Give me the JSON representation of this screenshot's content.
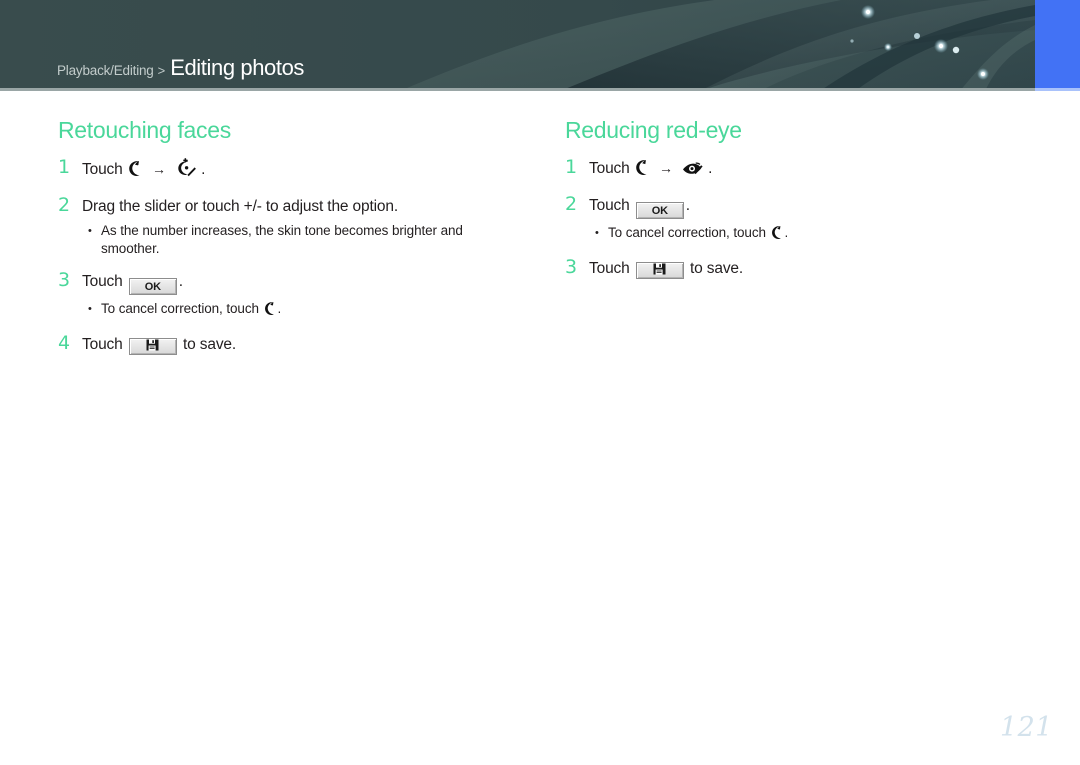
{
  "header": {
    "breadcrumb_parent": "Playback/Editing",
    "breadcrumb_separator": ">",
    "breadcrumb_current": "Editing photos",
    "background_color": "#3a4d4e",
    "accent_color": "#4272f5"
  },
  "theme": {
    "heading_color": "#4ad79a",
    "body_text_color": "#231f20",
    "page_number_color": "#d3e2ec"
  },
  "left_column": {
    "title": "Retouching faces",
    "steps": [
      {
        "number": "1",
        "text_before": "Touch",
        "icon_1": "face-retouch-cancel-icon",
        "arrow": "→",
        "icon_2": "face-retouch-icon",
        "text_after": "."
      },
      {
        "number": "2",
        "text": "Drag the slider or touch +/- to adjust the option.",
        "bullets": [
          "As the number increases, the skin tone becomes brighter and smoother."
        ]
      },
      {
        "number": "3",
        "text_before": "Touch",
        "button_label": "OK",
        "text_after": ".",
        "bullets_before": "To cancel correction, touch",
        "bullet_icon": "face-retouch-cancel-icon",
        "bullets_after": "."
      },
      {
        "number": "4",
        "text_before": "Touch",
        "button_icon": "save-floppy-icon",
        "text_after": "to save."
      }
    ]
  },
  "right_column": {
    "title": "Reducing red-eye",
    "steps": [
      {
        "number": "1",
        "text_before": "Touch",
        "icon_1": "face-retouch-cancel-icon",
        "arrow": "→",
        "icon_2": "red-eye-icon",
        "text_after": "."
      },
      {
        "number": "2",
        "text_before": "Touch",
        "button_label": "OK",
        "text_after": ".",
        "bullets_before": "To cancel correction, touch",
        "bullet_icon": "face-retouch-cancel-icon",
        "bullets_after": "."
      },
      {
        "number": "3",
        "text_before": "Touch",
        "button_icon": "save-floppy-icon",
        "text_after": "to save."
      }
    ]
  },
  "footer": {
    "page_number": "121"
  }
}
